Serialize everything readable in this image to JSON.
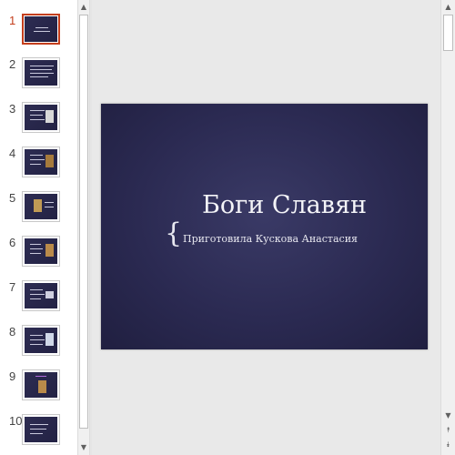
{
  "thumbnails": [
    {
      "number": "1",
      "active": true
    },
    {
      "number": "2",
      "active": false
    },
    {
      "number": "3",
      "active": false
    },
    {
      "number": "4",
      "active": false
    },
    {
      "number": "5",
      "active": false
    },
    {
      "number": "6",
      "active": false
    },
    {
      "number": "7",
      "active": false
    },
    {
      "number": "8",
      "active": false
    },
    {
      "number": "9",
      "active": false
    },
    {
      "number": "10",
      "active": false
    }
  ],
  "slide": {
    "title": "Боги Славян",
    "brace": "{",
    "subtitle": "Приготовила Кускова Анастасия"
  },
  "scrollbar": {
    "up_icon": "▲",
    "down_icon": "▼",
    "prev_slide_icon": "⯭",
    "next_slide_icon": "⯯"
  },
  "colors": {
    "active_accent": "#c43e1c",
    "slide_background": "#2b2a52"
  }
}
